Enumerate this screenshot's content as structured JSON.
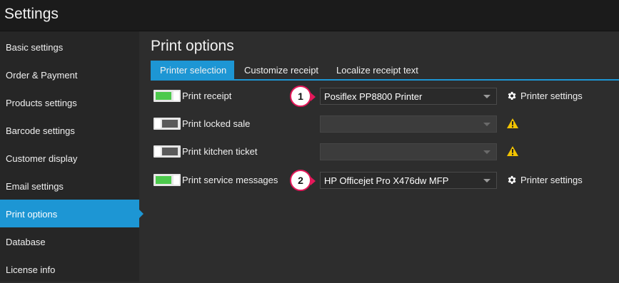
{
  "window": {
    "title": "Settings"
  },
  "sidebar": {
    "items": [
      {
        "label": "Basic settings"
      },
      {
        "label": "Order & Payment"
      },
      {
        "label": "Products settings"
      },
      {
        "label": "Barcode settings"
      },
      {
        "label": "Customer display"
      },
      {
        "label": "Email settings"
      },
      {
        "label": "Print options",
        "active": true
      },
      {
        "label": "Database"
      },
      {
        "label": "License info"
      }
    ]
  },
  "main": {
    "title": "Print options",
    "tabs": [
      {
        "label": "Printer selection",
        "active": true
      },
      {
        "label": "Customize receipt"
      },
      {
        "label": "Localize receipt text"
      }
    ],
    "rows": [
      {
        "label": "Print receipt",
        "enabled": true,
        "printer": "Posiflex PP8800 Printer",
        "settings_label": "Printer settings",
        "callout": "1"
      },
      {
        "label": "Print locked sale",
        "enabled": false,
        "printer": "",
        "warning": true
      },
      {
        "label": "Print kitchen ticket",
        "enabled": false,
        "printer": "",
        "warning": true
      },
      {
        "label": "Print service messages",
        "enabled": true,
        "printer": "HP Officejet Pro X476dw MFP",
        "settings_label": "Printer settings",
        "callout": "2"
      }
    ]
  },
  "colors": {
    "accent": "#1d96d4",
    "toggle_on": "#4cc94c",
    "callout_border": "#e4185a",
    "warning": "#f2c300"
  },
  "icons": {
    "settings": "gear-icon",
    "warning": "warning-triangle-icon",
    "dropdown": "chevron-down-icon"
  }
}
